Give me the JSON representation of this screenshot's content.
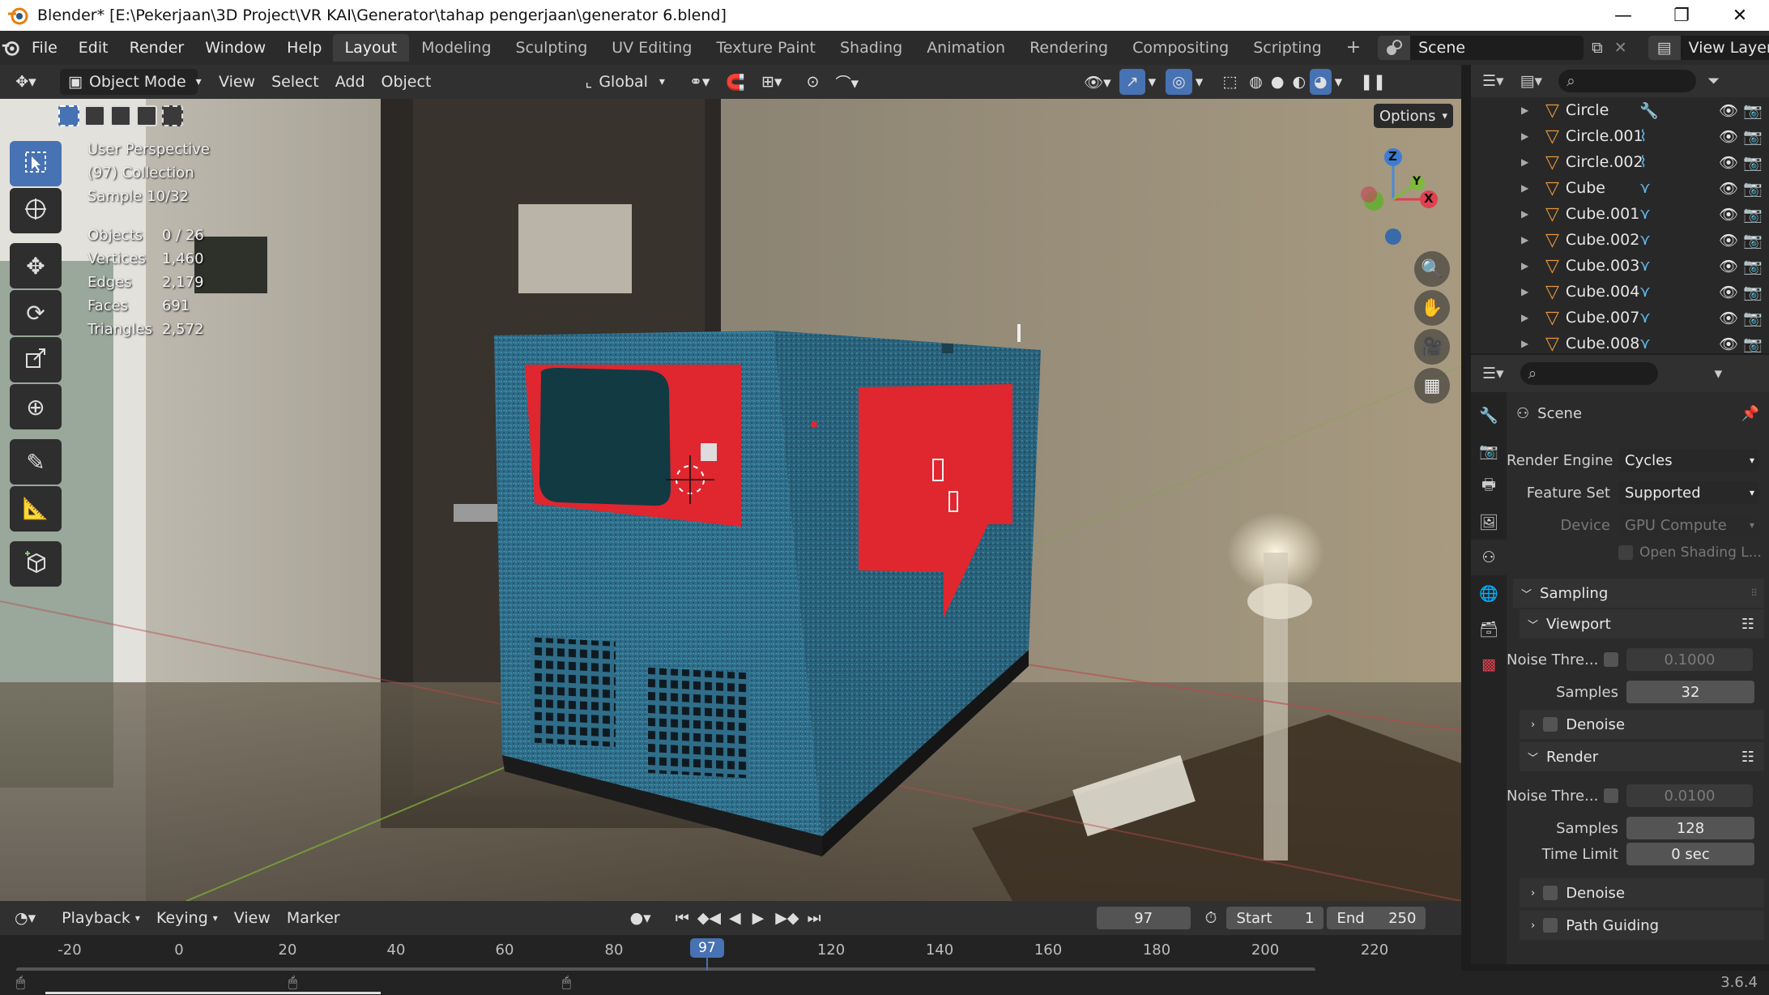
{
  "window": {
    "title": "Blender* [E:\\Pekerjaan\\3D Project\\VR KAI\\Generator\\tahap pengerjaan\\generator 6.blend]",
    "minimize": "—",
    "restore": "❐",
    "close": "✕"
  },
  "menu": [
    "File",
    "Edit",
    "Render",
    "Window",
    "Help"
  ],
  "workspaces": [
    "Layout",
    "Modeling",
    "Sculpting",
    "UV Editing",
    "Texture Paint",
    "Shading",
    "Animation",
    "Rendering",
    "Compositing",
    "Scripting"
  ],
  "workspace_add": "+",
  "scene": {
    "label": "Scene"
  },
  "viewlayer": {
    "label": "View Layer"
  },
  "header3d": {
    "mode": "Object Mode",
    "menus": [
      "View",
      "Select",
      "Add",
      "Object"
    ],
    "orientation": "Global",
    "options": "Options"
  },
  "overlay": {
    "perspective": "User Perspective",
    "collection": "(97) Collection",
    "sample": "Sample 10/32"
  },
  "stats": [
    {
      "k": "Objects",
      "v": "0 / 26"
    },
    {
      "k": "Vertices",
      "v": "1,460"
    },
    {
      "k": "Edges",
      "v": "2,179"
    },
    {
      "k": "Faces",
      "v": "691"
    },
    {
      "k": "Triangles",
      "v": "2,572"
    }
  ],
  "gizmo": {
    "z": "Z",
    "y": "Y",
    "x": "X"
  },
  "outliner": [
    {
      "name": "Circle",
      "mod": "wrench"
    },
    {
      "name": "Circle.001",
      "mod": "curve"
    },
    {
      "name": "Circle.002",
      "mod": "curve"
    },
    {
      "name": "Cube",
      "mod": "vert"
    },
    {
      "name": "Cube.001",
      "mod": "vert"
    },
    {
      "name": "Cube.002",
      "mod": "vert"
    },
    {
      "name": "Cube.003",
      "mod": "vert"
    },
    {
      "name": "Cube.004",
      "mod": "vert"
    },
    {
      "name": "Cube.007",
      "mod": "vert"
    },
    {
      "name": "Cube.008",
      "mod": "vert"
    }
  ],
  "properties": {
    "context": "Scene",
    "render_engine_label": "Render Engine",
    "render_engine": "Cycles",
    "feature_set_label": "Feature Set",
    "feature_set": "Supported",
    "device_label": "Device",
    "device": "GPU Compute",
    "osl": "Open Shading L...",
    "sampling": "Sampling",
    "viewport": "Viewport",
    "vp_noise_label": "Noise Thre...",
    "vp_noise": "0.1000",
    "vp_samples_label": "Samples",
    "vp_samples": "32",
    "vp_denoise": "Denoise",
    "render": "Render",
    "r_noise_label": "Noise Thre...",
    "r_noise": "0.0100",
    "r_samples_label": "Samples",
    "r_samples": "128",
    "time_limit_label": "Time Limit",
    "time_limit": "0 sec",
    "r_denoise": "Denoise",
    "path_guiding": "Path Guiding"
  },
  "timeline": {
    "menus": [
      "Playback",
      "Keying",
      "View",
      "Marker"
    ],
    "current_frame": "97",
    "start_label": "Start",
    "start": "1",
    "end_label": "End",
    "end": "250",
    "ticks": [
      "-20",
      "0",
      "20",
      "40",
      "60",
      "80",
      "120",
      "140",
      "160",
      "180",
      "200",
      "220"
    ],
    "playhead": "97"
  },
  "version": "3.6.4",
  "colors": {
    "accent": "#4772b3",
    "object_orange": "#e8953a",
    "gen_blue": "#2e6e8a",
    "gen_red": "#e0262f"
  }
}
